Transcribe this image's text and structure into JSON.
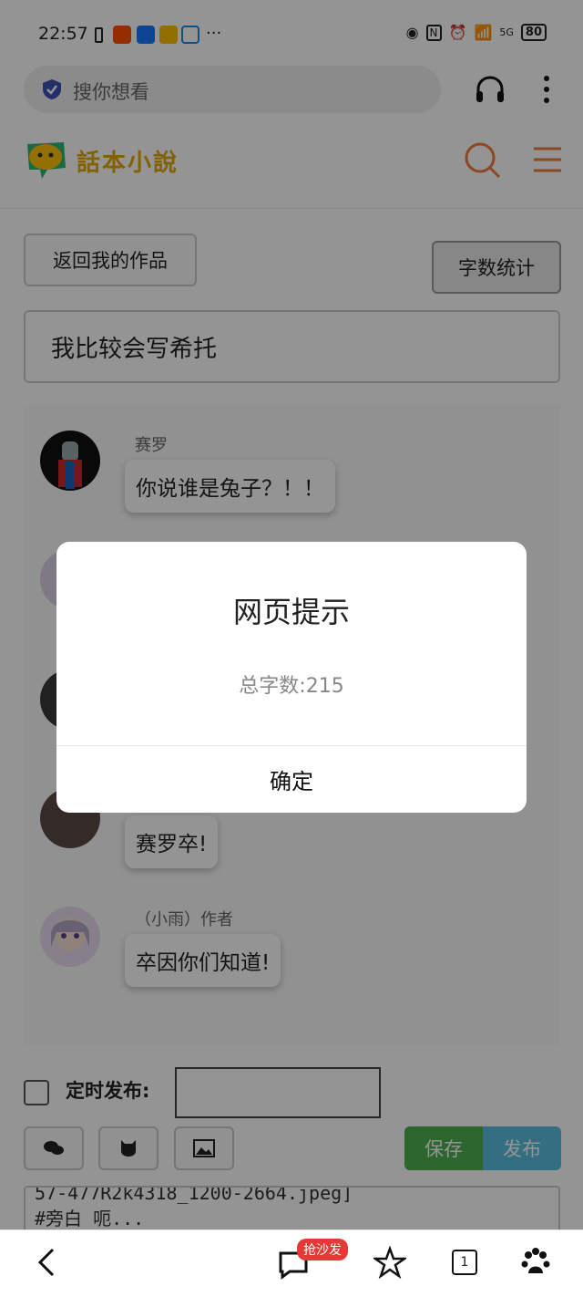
{
  "status_bar": {
    "time": "22:57",
    "more": "···",
    "network": "5G",
    "battery": "80"
  },
  "browser": {
    "search_placeholder": "搜你想看"
  },
  "site": {
    "logo_text": "話本小說"
  },
  "editor": {
    "back_label": "返回我的作品",
    "word_count_label": "字数统计",
    "work_title": "我比较会写希托"
  },
  "messages": [
    {
      "author": "赛罗",
      "text": "你说谁是兔子？！！"
    },
    {
      "author": "",
      "text": ""
    },
    {
      "author": "",
      "text": ""
    },
    {
      "author": "",
      "text": "赛罗卒!"
    },
    {
      "author": "（小雨）作者",
      "text": "卒因你们知道!"
    }
  ],
  "publish": {
    "timed_label": "定时发布:",
    "timed_value": "",
    "save_label": "保存",
    "publish_label": "发布",
    "content_line1": "57-477R2k4318_1200-2664.jpeg]",
    "content_line2": "#旁白 呃..."
  },
  "bottom_nav": {
    "sofa_badge": "抢沙发",
    "tabs_count": "1"
  },
  "dialog": {
    "title": "网页提示",
    "message": "总字数:215",
    "ok_label": "确定"
  },
  "colors": {
    "save": "#4caf50",
    "publish": "#5bc0de",
    "logo": "#e0a800",
    "badge": "#e53935"
  }
}
